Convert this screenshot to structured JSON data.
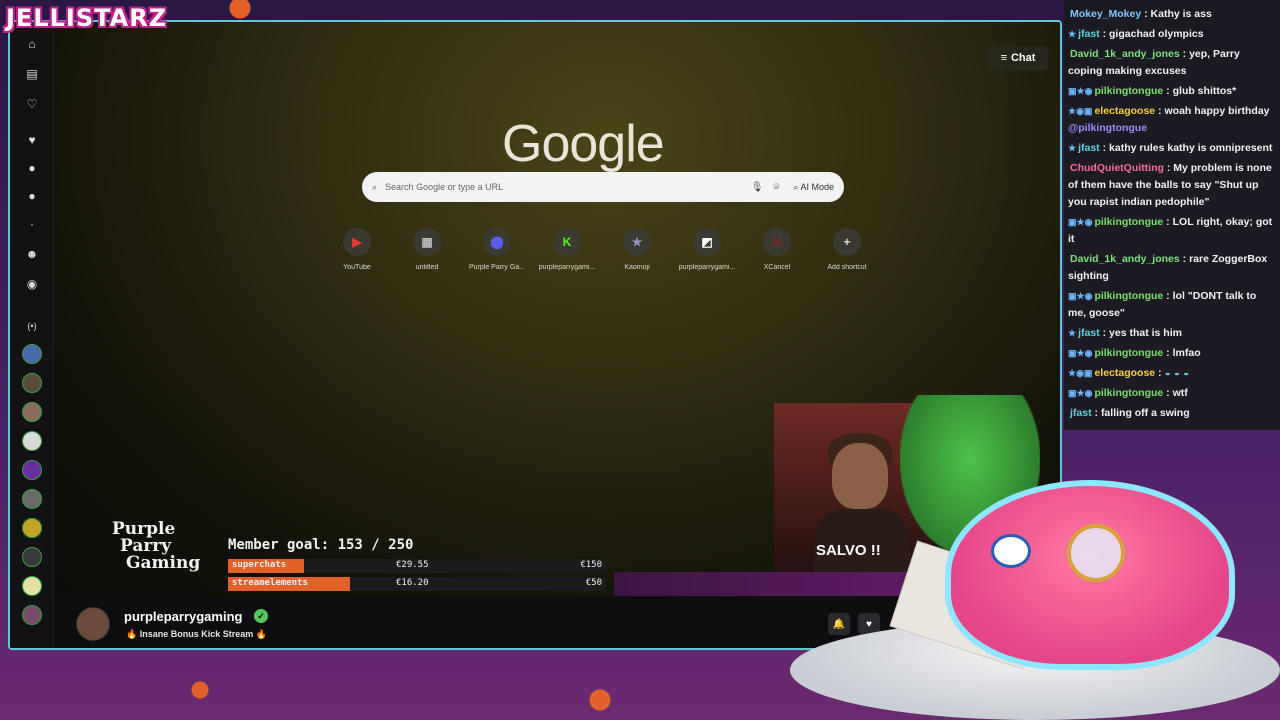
{
  "overlay": {
    "logo": "JELLISTARZ"
  },
  "browser": {
    "chat_button": "Chat",
    "google_logo": "Google",
    "search_placeholder": "Search Google or type a URL",
    "ai_mode": "AI Mode",
    "shortcuts": [
      {
        "label": "YouTube",
        "icon": "youtube-icon",
        "glyph": "▶",
        "color": "#e53935"
      },
      {
        "label": "untitled",
        "icon": "page-icon",
        "glyph": "▦",
        "color": "#bbbbbb"
      },
      {
        "label": "Purple Parry Ga...",
        "icon": "purple-app-icon",
        "glyph": "⬤",
        "color": "#5b5bf0"
      },
      {
        "label": "purpleparrygami...",
        "icon": "kick-icon",
        "glyph": "K",
        "color": "#53fc18"
      },
      {
        "label": "Kaomoji",
        "icon": "star-icon",
        "glyph": "★",
        "color": "#9a8fbf"
      },
      {
        "label": "purpleparrygami...",
        "icon": "app-icon",
        "glyph": "◩",
        "color": "#ffffff"
      },
      {
        "label": "XCancel",
        "icon": "xcancel-icon",
        "glyph": "M",
        "color": "#7a2a2a"
      },
      {
        "label": "Add shortcut",
        "icon": "plus-icon",
        "glyph": "+",
        "color": "#dddddd"
      }
    ]
  },
  "goal": {
    "brand_line1": "Purple",
    "brand_line2": "Parry",
    "brand_line3": "Gaming",
    "title": "Member goal: 153 / 250",
    "rows": [
      {
        "label": "superchats",
        "current": "€29.55",
        "target": "€150"
      },
      {
        "label": "streamelements",
        "current": "€16.20",
        "target": "€50"
      }
    ]
  },
  "cam": {
    "label": "SALVO !!"
  },
  "stream": {
    "streamer": "purpleparrygaming",
    "title": "🔥 Insane Bonus Kick Stream 🔥"
  },
  "chat": {
    "messages": [
      {
        "badges": "",
        "user": "Mokey_Mokey",
        "color": "#7fc8ff",
        "text": "Kathy is ass"
      },
      {
        "badges": "★",
        "user": "jfast",
        "color": "#5fd3e0",
        "text": "gigachad olympics"
      },
      {
        "badges": "",
        "user": "David_1k_andy_jones",
        "color": "#7be07b",
        "text": "yep, Parry coping making excuses"
      },
      {
        "badges": "▣★◉",
        "user": "pilkingtongue",
        "color": "#79e06b",
        "text": "glub shittos*"
      },
      {
        "badges": "★◉▣",
        "user": "electagoose",
        "color": "#f5d142",
        "text": "woah happy birthday",
        "mention": "@pilkingtongue"
      },
      {
        "badges": "★",
        "user": "jfast",
        "color": "#5fd3e0",
        "text": "kathy rules kathy is omnipresent"
      },
      {
        "badges": "",
        "user": "ChudQuietQuitting",
        "color": "#ff6b9a",
        "text": "My problem is none of them have the balls to say \"Shut up you rapist indian pedophile\""
      },
      {
        "badges": "▣★◉",
        "user": "pilkingtongue",
        "color": "#79e06b",
        "text": "LOL right, okay; got it"
      },
      {
        "badges": "",
        "user": "David_1k_andy_jones",
        "color": "#7be07b",
        "text": "rare ZoggerBox sighting"
      },
      {
        "badges": "▣★◉",
        "user": "pilkingtongue",
        "color": "#79e06b",
        "text": "lol \"DONT talk to me, goose\""
      },
      {
        "badges": "★",
        "user": "jfast",
        "color": "#5fd3e0",
        "text": "yes that is him"
      },
      {
        "badges": "▣★◉",
        "user": "pilkingtongue",
        "color": "#79e06b",
        "text": "lmfao"
      },
      {
        "badges": "★◉▣",
        "user": "electagoose",
        "color": "#f5d142",
        "text": "◒ ◒ ◒"
      },
      {
        "badges": "▣★◉",
        "user": "pilkingtongue",
        "color": "#79e06b",
        "text": "wtf"
      },
      {
        "badges": "",
        "user": "jfast",
        "color": "#5fd3e0",
        "text": "falling off a swing"
      }
    ]
  }
}
